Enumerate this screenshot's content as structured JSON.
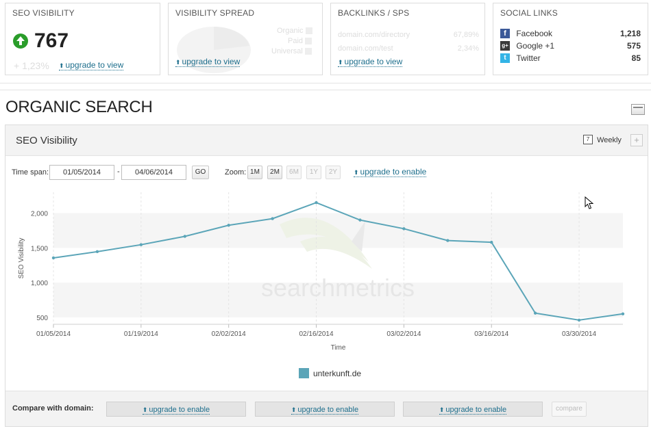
{
  "widgets": {
    "seo_visibility": {
      "title": "SEO VISIBILITY",
      "value": "767",
      "change": "+ 1,23%",
      "upgrade_label": "upgrade to view"
    },
    "visibility_spread": {
      "title": "VISIBILITY SPREAD",
      "legend": [
        "Organic",
        "Paid",
        "Universal"
      ],
      "upgrade_label": "upgrade to view"
    },
    "backlinks": {
      "title": "BACKLINKS / SPS",
      "rows": [
        {
          "label": "domain.com/directory",
          "value": "67,89%"
        },
        {
          "label": "domain.com/test",
          "value": "2,34%"
        }
      ],
      "upgrade_label": "upgrade to view"
    },
    "social": {
      "title": "SOCIAL LINKS",
      "items": [
        {
          "name": "Facebook",
          "count": "1,218",
          "icon": "facebook-icon",
          "color": "#3b5998"
        },
        {
          "name": "Google +1",
          "count": "575",
          "icon": "google-plus-icon",
          "color": "#3a3a3a"
        },
        {
          "name": "Twitter",
          "count": "85",
          "icon": "twitter-icon",
          "color": "#33b4e6"
        }
      ]
    }
  },
  "section_title": "ORGANIC SEARCH",
  "panel": {
    "title": "SEO Visibility",
    "interval_label": "Weekly",
    "add_label": "+",
    "timespan_label": "Time span:",
    "date_from": "01/05/2014",
    "date_sep": "-",
    "date_to": "04/06/2014",
    "go_label": "GO",
    "zoom_label": "Zoom:",
    "zoom_options": [
      "1M",
      "2M",
      "6M",
      "1Y",
      "2Y"
    ],
    "zoom_upgrade": "upgrade to enable"
  },
  "chart_data": {
    "type": "line",
    "x": [
      "01/05/2014",
      "01/12/2014",
      "01/19/2014",
      "01/26/2014",
      "02/02/2014",
      "02/09/2014",
      "02/16/2014",
      "02/23/2014",
      "03/02/2014",
      "03/09/2014",
      "03/16/2014",
      "03/23/2014",
      "03/30/2014",
      "04/06/2014"
    ],
    "series": [
      {
        "name": "unterkunft.de",
        "values": [
          1355,
          1445,
          1545,
          1665,
          1825,
          1920,
          2150,
          1900,
          1775,
          1605,
          1580,
          560,
          460,
          550
        ],
        "color": "#5ba5b8"
      }
    ],
    "xticks": [
      "01/05/2014",
      "01/19/2014",
      "02/02/2014",
      "02/16/2014",
      "03/02/2014",
      "03/16/2014",
      "03/30/2014"
    ],
    "yticks": [
      "500",
      "1,000",
      "1,500",
      "2,000"
    ],
    "xlabel": "Time",
    "ylabel": "SEO Visibility",
    "ylim": [
      400,
      2300
    ],
    "grid": "vertical dashed, horizontal bands",
    "watermark": "searchmetrics",
    "legend_position": "bottom-center"
  },
  "compare": {
    "label": "Compare with domain:",
    "slots": [
      "upgrade to enable",
      "upgrade to enable",
      "upgrade to enable"
    ],
    "button_label": "compare"
  }
}
